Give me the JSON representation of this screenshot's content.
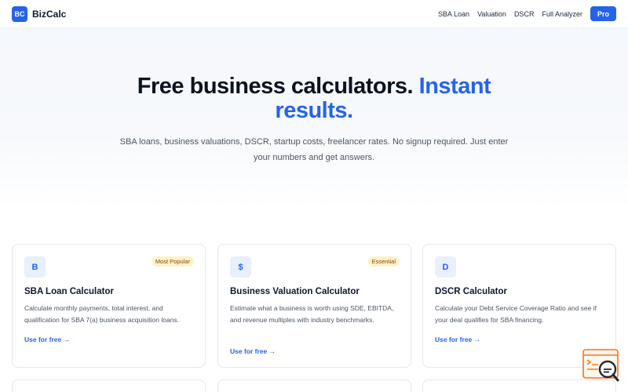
{
  "header": {
    "logo_text": "BC",
    "brand": "BizCalc",
    "nav": [
      "SBA Loan",
      "Valuation",
      "DSCR",
      "Full Analyzer"
    ],
    "pro_label": "Pro"
  },
  "hero": {
    "title_main": "Free business calculators.",
    "title_accent_1": "Instant",
    "title_accent_2": "results.",
    "subtitle": "SBA loans, business valuations, DSCR, startup costs, freelancer rates. No signup required. Just enter your numbers and get answers."
  },
  "cards": [
    {
      "icon": "B",
      "tag": "Most Popular",
      "title": "SBA Loan Calculator",
      "desc": "Calculate monthly payments, total interest, and qualification for SBA 7(a) business acquisition loans.",
      "link": "Use for free →"
    },
    {
      "icon": "$",
      "tag": "Essential",
      "title": "Business Valuation Calculator",
      "desc": "Estimate what a business is worth using SDE, EBITDA, and revenue multiples with industry benchmarks.",
      "link": "Use for free →"
    },
    {
      "icon": "D",
      "tag": "",
      "title": "DSCR Calculator",
      "desc": "Calculate your Debt Service Coverage Ratio and see if your deal qualifies for SBA financing.",
      "link": "Use for free →"
    }
  ],
  "colors": {
    "accent": "#2563eb",
    "tag_bg": "#fdf3c7",
    "tag_text": "#92400e",
    "help_orange": "#f97316"
  }
}
